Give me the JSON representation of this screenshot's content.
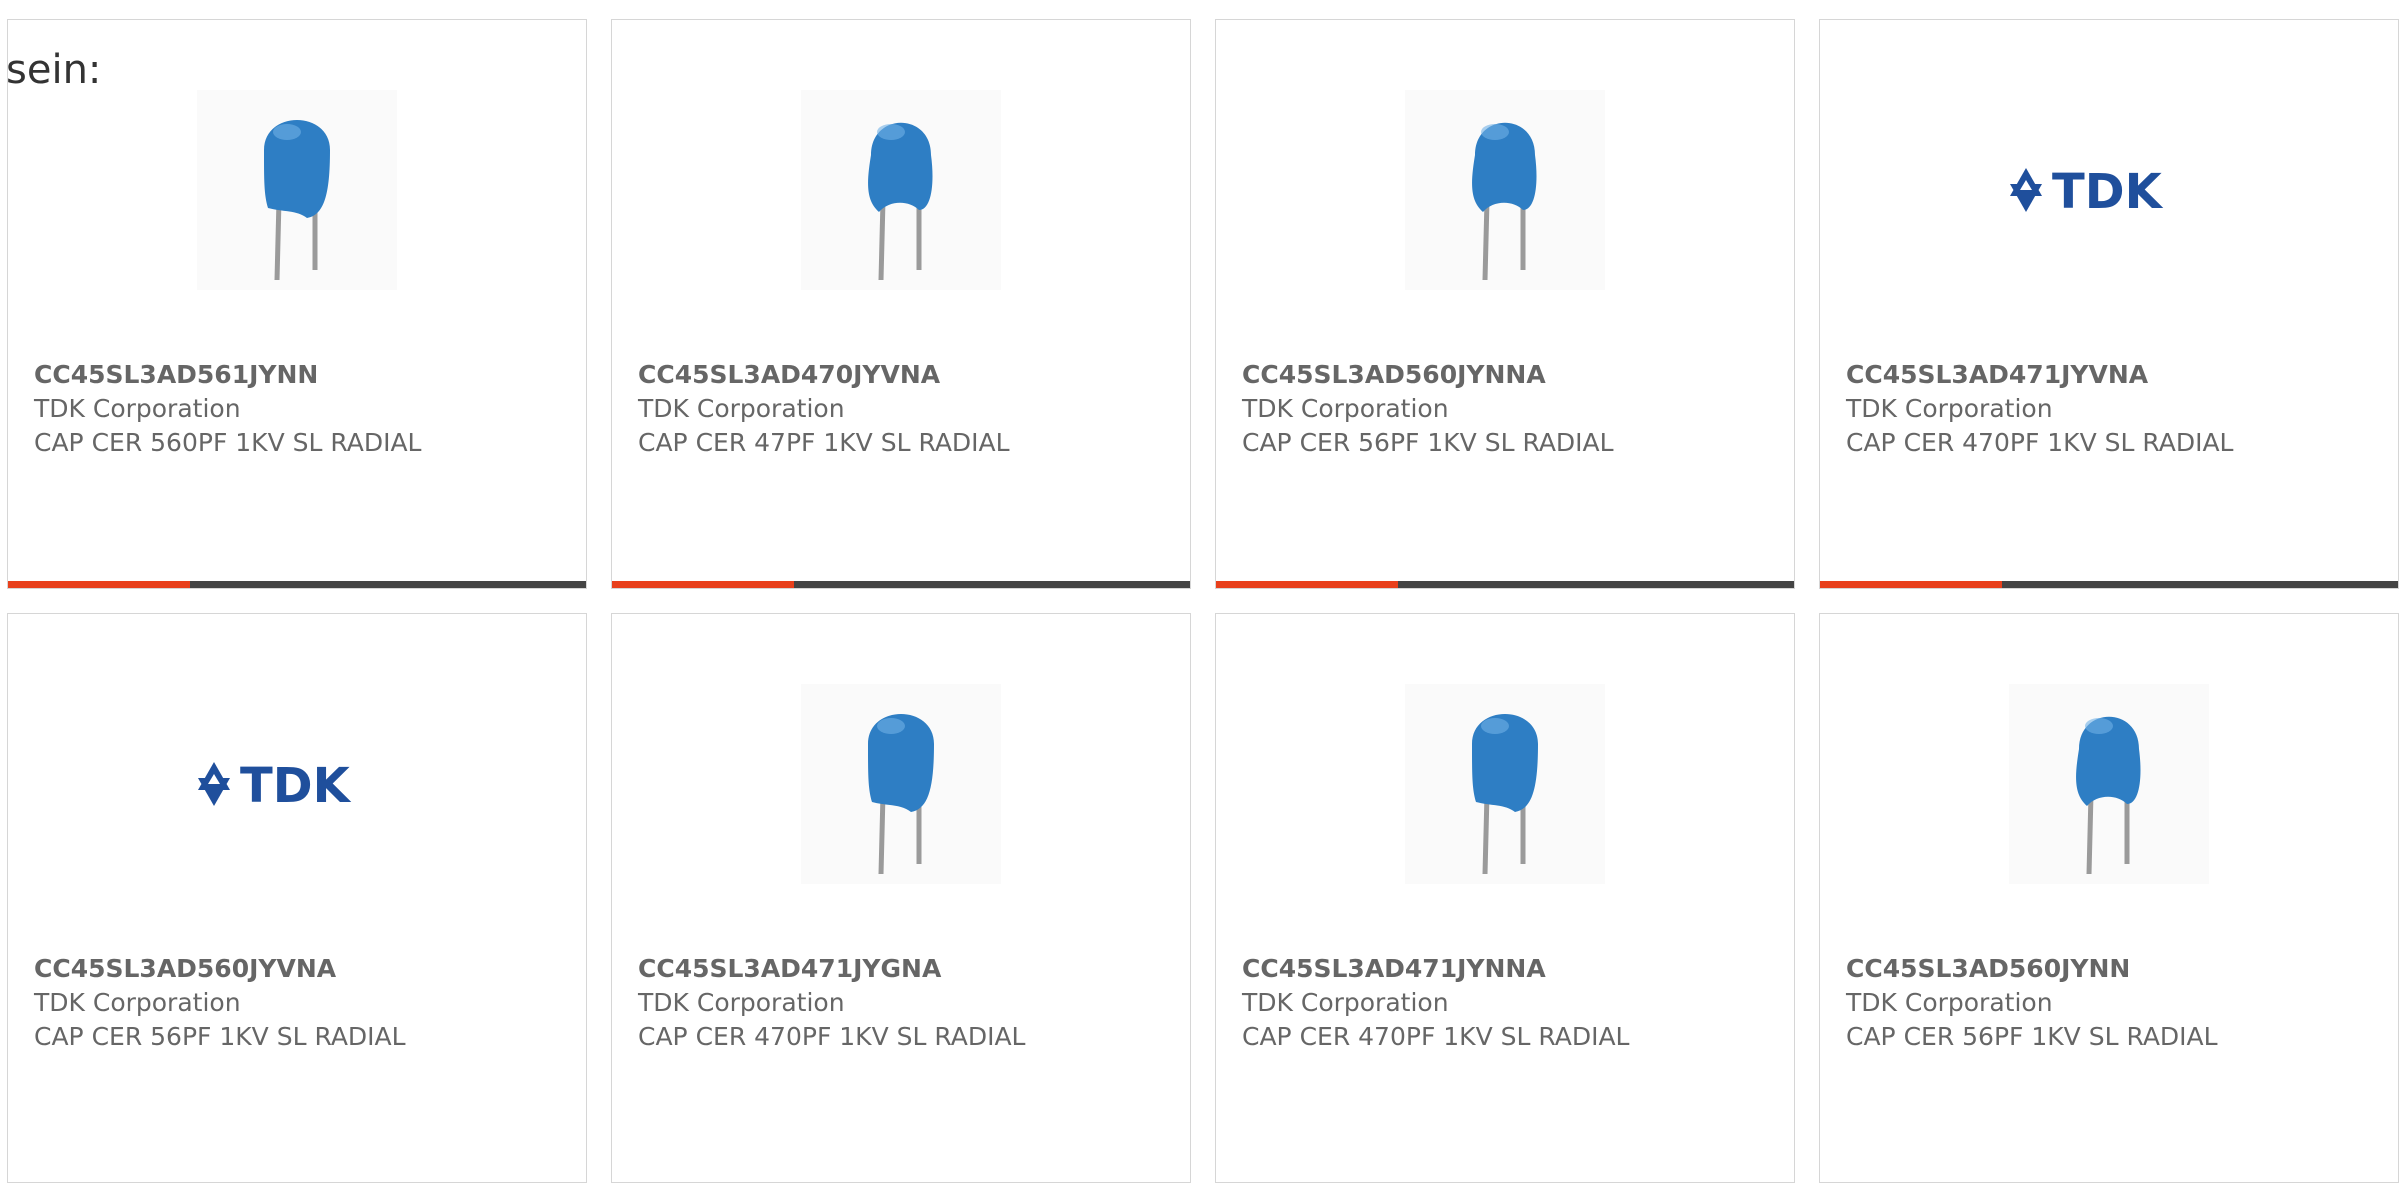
{
  "intro_text": "sein:",
  "colors": {
    "accent": "#e8401c",
    "bar_dark": "#444444",
    "capacitor_blue": "#2e7ec4",
    "tdk_blue": "#1f4f9c",
    "text": "#666666"
  },
  "products": [
    {
      "part_number": "CC45SL3AD561JYNN",
      "manufacturer": "TDK Corporation",
      "description": "CAP CER 560PF 1KV SL RADIAL",
      "image": "capacitor-wide",
      "has_bar": true
    },
    {
      "part_number": "CC45SL3AD470JYVNA",
      "manufacturer": "TDK Corporation",
      "description": "CAP CER 47PF 1KV SL RADIAL",
      "image": "capacitor-narrow",
      "has_bar": true
    },
    {
      "part_number": "CC45SL3AD560JYNNA",
      "manufacturer": "TDK Corporation",
      "description": "CAP CER 56PF 1KV SL RADIAL",
      "image": "capacitor-narrow",
      "has_bar": true
    },
    {
      "part_number": "CC45SL3AD471JYVNA",
      "manufacturer": "TDK Corporation",
      "description": "CAP CER 470PF 1KV SL RADIAL",
      "image": "tdk-logo",
      "has_bar": true
    },
    {
      "part_number": "CC45SL3AD560JYVNA",
      "manufacturer": "TDK Corporation",
      "description": "CAP CER 56PF 1KV SL RADIAL",
      "image": "tdk-logo",
      "has_bar": false
    },
    {
      "part_number": "CC45SL3AD471JYGNA",
      "manufacturer": "TDK Corporation",
      "description": "CAP CER 470PF 1KV SL RADIAL",
      "image": "capacitor-wide",
      "has_bar": false
    },
    {
      "part_number": "CC45SL3AD471JYNNA",
      "manufacturer": "TDK Corporation",
      "description": "CAP CER 470PF 1KV SL RADIAL",
      "image": "capacitor-wide",
      "has_bar": false
    },
    {
      "part_number": "CC45SL3AD560JYNN",
      "manufacturer": "TDK Corporation",
      "description": "CAP CER 56PF 1KV SL RADIAL",
      "image": "capacitor-narrow",
      "has_bar": false
    }
  ],
  "logo_text": "TDK"
}
